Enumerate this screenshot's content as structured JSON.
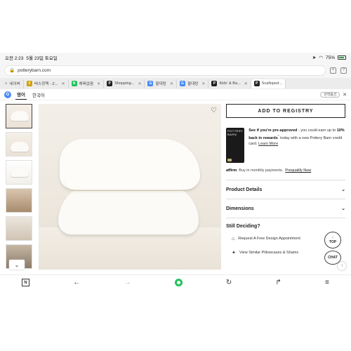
{
  "status_bar": {
    "time": "오전 2:23",
    "date": "5월 23일 토요일",
    "battery": "75%"
  },
  "browser": {
    "url": "potterybarn.com",
    "tabs": [
      {
        "label": "네이버",
        "icon": "home-icon",
        "color": "#888888"
      },
      {
        "label": "버스정책 - Z...",
        "icon": "page-icon",
        "color": "#cfa000"
      },
      {
        "label": "체육없음",
        "icon": "naver-icon",
        "color": "#1fc35c"
      },
      {
        "label": "Shopping...",
        "icon": "page-icon",
        "color": "#222222"
      },
      {
        "label": "팔대탕",
        "icon": "page-icon",
        "color": "#4a8af4"
      },
      {
        "label": "팔대탕",
        "icon": "page-icon",
        "color": "#4a8af4"
      },
      {
        "label": "Kids' & Ba...",
        "icon": "page-icon",
        "color": "#222222"
      },
      {
        "label": "Scalloped...",
        "icon": "page-icon",
        "color": "#222222"
      }
    ]
  },
  "translate_bar": {
    "lang_from": "영어",
    "lang_to": "한국어",
    "options_label": "번역옵션"
  },
  "product": {
    "registry_button": "ADD TO REGISTRY",
    "card_brand": "POTTERY BARN",
    "promo": {
      "lead": "See if you're pre-approved",
      "mid": " - you could earn up to ",
      "bold": "10% back in rewards",
      "sup": "*",
      "tail": " today with a new Pottery Barn credit card. ",
      "link": "Learn More"
    },
    "affirm": {
      "brand": "affirm",
      "text": "Buy in monthly payments.",
      "link": "Prequalify Now"
    },
    "accordion": [
      {
        "label": "Product Details"
      },
      {
        "label": "Dimensions"
      }
    ],
    "still_deciding": "Still Deciding?",
    "links": [
      {
        "label": "Request A Free Design Appointment",
        "icon": "house-icon"
      },
      {
        "label": "View Similar Pillowcases & Shams",
        "icon": "sparkle-icon"
      }
    ]
  },
  "floating": {
    "top_label": "TOP",
    "chat_label": "CHAT"
  }
}
